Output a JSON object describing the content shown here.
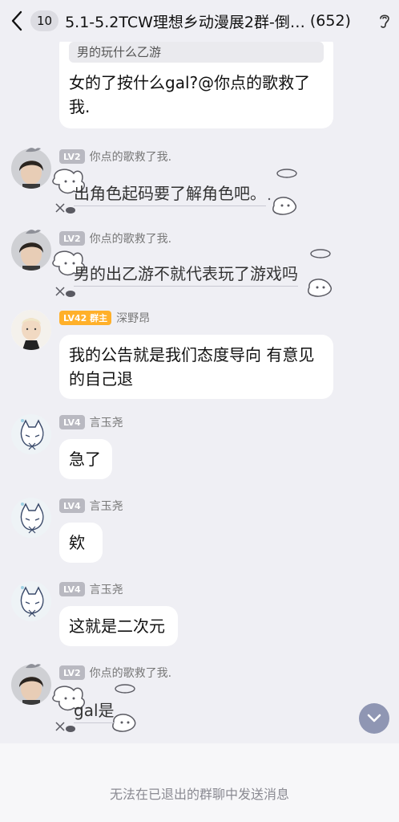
{
  "header": {
    "unread_count": "10",
    "title": "5.1-5.2TCW理想乡动漫展2群-倒…",
    "member_count": "(652)"
  },
  "messages": [
    {
      "id": "m0",
      "quote": "男的玩什么乙游",
      "text": "女的了按什么gal?@你点的歌救了我."
    },
    {
      "id": "m1",
      "level": "LV2",
      "sender": "你点的歌救了我.",
      "text": "出角色起码要了解角色吧。"
    },
    {
      "id": "m2",
      "level": "LV2",
      "sender": "你点的歌救了我.",
      "text": "男的出乙游不就代表玩了游戏吗"
    },
    {
      "id": "m3",
      "level": "LV42 群主",
      "sender": "深野昂",
      "text": "我的公告就是我们态度导向  有意见的自己退"
    },
    {
      "id": "m4",
      "level": "LV4",
      "sender": "言玉尧",
      "text": "急了"
    },
    {
      "id": "m5",
      "level": "LV4",
      "sender": "言玉尧",
      "text": "欸"
    },
    {
      "id": "m6",
      "level": "LV4",
      "sender": "言玉尧",
      "text": "这就是二次元"
    },
    {
      "id": "m7",
      "level": "LV2",
      "sender": "你点的歌救了我.",
      "text": "gal是"
    }
  ],
  "footer": {
    "notice": "无法在已退出的群聊中发送消息"
  },
  "colors": {
    "background": "#efeff4",
    "bubble": "#ffffff",
    "owner_badge": "#ffb02a",
    "level_badge": "#b9b9c1",
    "scroll_button": "#8f96b3"
  }
}
